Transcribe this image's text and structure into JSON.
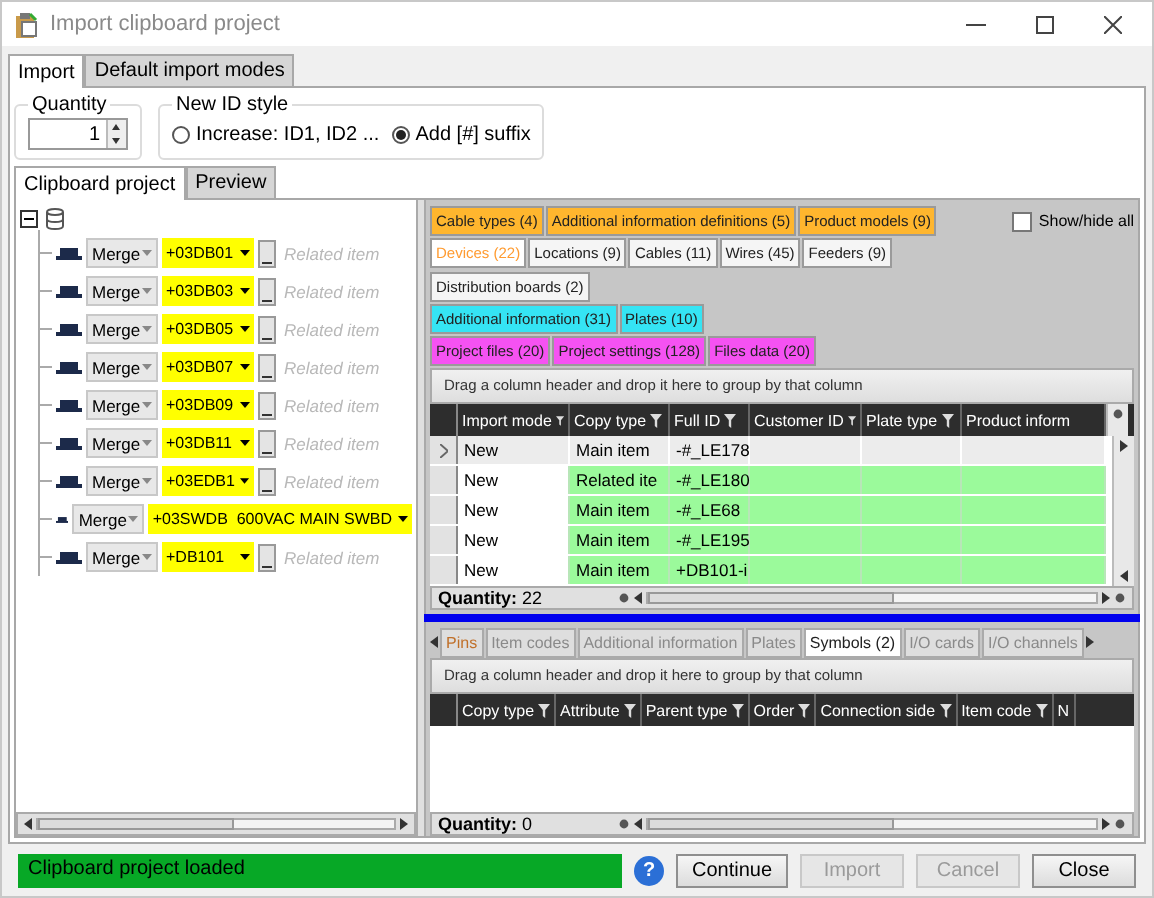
{
  "window": {
    "title": "Import clipboard project"
  },
  "main_tabs": [
    {
      "label": "Import",
      "selected": true
    },
    {
      "label": "Default import modes",
      "selected": false
    }
  ],
  "quantity": {
    "label": "Quantity",
    "value": "1"
  },
  "id_style": {
    "label": "New ID style",
    "options": [
      {
        "label": "Increase: ID1, ID2 ...",
        "selected": false
      },
      {
        "label": "Add [#] suffix",
        "selected": true
      }
    ]
  },
  "sub_tabs": [
    {
      "label": "Clipboard project",
      "selected": true
    },
    {
      "label": "Preview",
      "selected": false
    }
  ],
  "tree": {
    "expanded": true,
    "items": [
      {
        "mode": "Merge",
        "id": "+03DB01",
        "related": "Related item"
      },
      {
        "mode": "Merge",
        "id": "+03DB03",
        "related": "Related item"
      },
      {
        "mode": "Merge",
        "id": "+03DB05",
        "related": "Related item"
      },
      {
        "mode": "Merge",
        "id": "+03DB07",
        "related": "Related item"
      },
      {
        "mode": "Merge",
        "id": "+03DB09",
        "related": "Related item"
      },
      {
        "mode": "Merge",
        "id": "+03DB11",
        "related": "Related item"
      },
      {
        "mode": "Merge",
        "id": "+03EDB1",
        "related": "Related item"
      },
      {
        "mode": "Merge",
        "id": "+03SWDB  600VAC MAIN SWBD"
      },
      {
        "mode": "Merge",
        "id": "+DB101",
        "related": "Related item"
      }
    ]
  },
  "show_hide_all": {
    "label": "Show/hide all",
    "checked": false
  },
  "tab_groups": [
    {
      "color": "#ffb62e",
      "tabs": [
        {
          "label": "Cable types (4)",
          "selected": false
        },
        {
          "label": "Additional information definitions (5)",
          "selected": false
        },
        {
          "label": "Product models (9)",
          "selected": false
        }
      ]
    },
    {
      "color": "#f5f5f5",
      "tabs": [
        {
          "label": "Devices (22)",
          "selected": true
        },
        {
          "label": "Locations (9)",
          "selected": false
        },
        {
          "label": "Cables (11)",
          "selected": false
        },
        {
          "label": "Wires (45)",
          "selected": false
        },
        {
          "label": "Feeders (9)",
          "selected": false
        },
        {
          "label": "Distribution boards (2)",
          "selected": false
        }
      ]
    },
    {
      "color": "#35e4f4",
      "tabs": [
        {
          "label": "Additional information (31)",
          "selected": false
        },
        {
          "label": "Plates (10)",
          "selected": false
        }
      ]
    },
    {
      "color": "#f552f2",
      "tabs": [
        {
          "label": "Project files (20)",
          "selected": false
        },
        {
          "label": "Project settings (128)",
          "selected": false
        },
        {
          "label": "Files data (20)",
          "selected": false
        }
      ]
    }
  ],
  "top_grid": {
    "group_hint": "Drag a column header and drop it here to group by that column",
    "columns": [
      {
        "label": "Import mode",
        "filter": true
      },
      {
        "label": "Copy type",
        "filter": true
      },
      {
        "label": "Full ID",
        "filter": true
      },
      {
        "label": "Customer ID",
        "filter": true
      },
      {
        "label": "Plate type",
        "filter": true
      },
      {
        "label": "Product inform",
        "filter": false
      }
    ],
    "rows": [
      {
        "current": true,
        "cells": [
          "New",
          "Main item",
          "-#_LE178"
        ]
      },
      {
        "current": false,
        "cells": [
          "New",
          "Related ite",
          "-#_LE180"
        ]
      },
      {
        "current": false,
        "cells": [
          "New",
          "Main item",
          "-#_LE68"
        ]
      },
      {
        "current": false,
        "cells": [
          "New",
          "Main item",
          "-#_LE195"
        ]
      },
      {
        "current": false,
        "cells": [
          "New",
          "Main item",
          "+DB101-i"
        ]
      }
    ],
    "quantity_label": "Quantity:",
    "quantity": "22"
  },
  "bottom_tabs": [
    {
      "label": "Pins",
      "selected": true,
      "disabled": true
    },
    {
      "label": "Item codes",
      "selected": false,
      "disabled": true
    },
    {
      "label": "Additional information",
      "selected": false,
      "disabled": true
    },
    {
      "label": "Plates",
      "selected": false,
      "disabled": true
    },
    {
      "label": "Symbols (2)",
      "selected": false,
      "disabled": false
    },
    {
      "label": "I/O cards",
      "selected": false,
      "disabled": true
    },
    {
      "label": "I/O channels",
      "selected": false,
      "disabled": true
    }
  ],
  "bottom_grid": {
    "group_hint": "Drag a column header and drop it here to group by that column",
    "columns": [
      {
        "label": "Copy type",
        "filter": true
      },
      {
        "label": "Attribute",
        "filter": true
      },
      {
        "label": "Parent type",
        "filter": true
      },
      {
        "label": "Order",
        "filter": true
      },
      {
        "label": "Connection side",
        "filter": true
      },
      {
        "label": "Item code",
        "filter": true
      },
      {
        "label": "N",
        "filter": false
      }
    ],
    "quantity_label": "Quantity:",
    "quantity": "0"
  },
  "status": {
    "text": "Clipboard project loaded",
    "help": "?"
  },
  "buttons": [
    {
      "label": "Continue",
      "disabled": false
    },
    {
      "label": "Import",
      "disabled": true
    },
    {
      "label": "Cancel",
      "disabled": true
    },
    {
      "label": "Close",
      "disabled": false
    }
  ]
}
